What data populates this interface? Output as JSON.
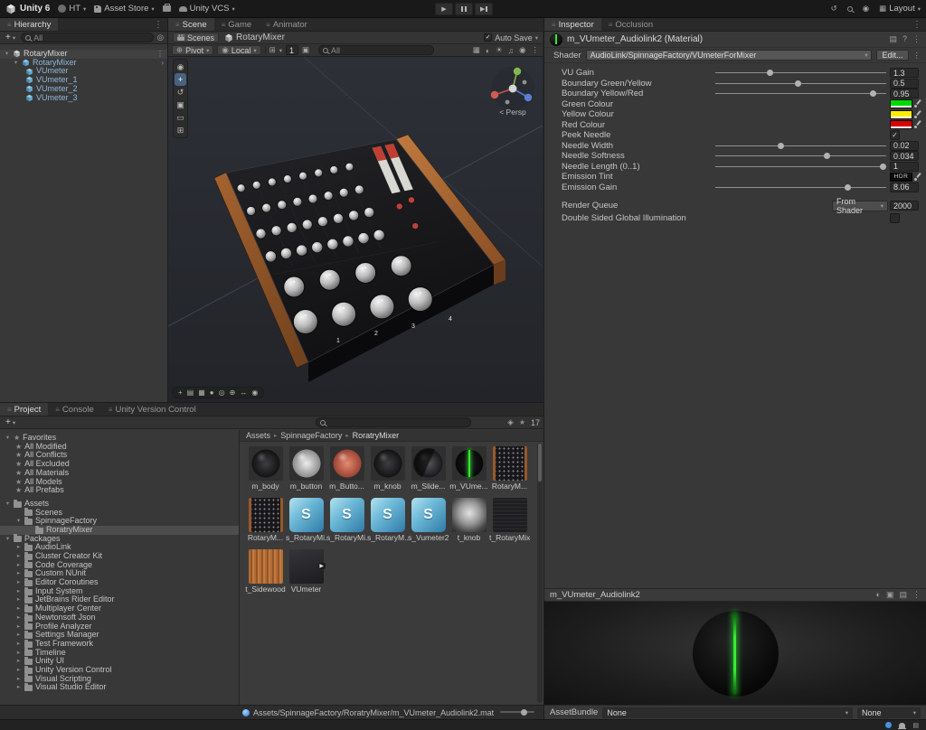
{
  "topbar": {
    "unity_version": "Unity 6",
    "account": "HT",
    "asset_store": "Asset Store",
    "unity_vcs": "Unity VCS",
    "layout": "Layout"
  },
  "hierarchy": {
    "tab": "Hierarchy",
    "search_placeholder": "All",
    "scene_name": "RotaryMixer",
    "prefab_root": "RotaryMixer",
    "children": [
      "VUmeter",
      "VUmeter_1",
      "VUmeter_2",
      "VUmeter_3"
    ]
  },
  "scene_view": {
    "tabs": [
      "Scene",
      "Game",
      "Animator"
    ],
    "scenes_button": "Scenes",
    "scene_breadcrumb": "RotaryMixer",
    "auto_save": "Auto Save",
    "pivot": "Pivot",
    "orientation": "Local",
    "grid_size": "1",
    "search_placeholder": "All",
    "gizmo_label": "< Persp",
    "channel_numbers": [
      "1",
      "2",
      "3",
      "4"
    ]
  },
  "inspector": {
    "tabs": [
      "Inspector",
      "Occlusion"
    ],
    "material_title": "m_VUmeter_Audiolink2 (Material)",
    "shader_label": "Shader",
    "shader_name": "AudioLink/SpinnageFactory/VUmeterForMixer",
    "edit_button": "Edit...",
    "properties": [
      {
        "label": "VU Gain",
        "type": "slider",
        "value": "1.3"
      },
      {
        "label": "Boundary Green/Yellow",
        "type": "slider",
        "value": "0.5"
      },
      {
        "label": "Boundary Yellow/Red",
        "type": "slider",
        "value": "0.95"
      },
      {
        "label": "Green Colour",
        "type": "color",
        "color": "#00d800"
      },
      {
        "label": "Yellow Colour",
        "type": "color",
        "color": "#ffee00"
      },
      {
        "label": "Red Colour",
        "type": "color",
        "color": "#d80000"
      },
      {
        "label": "Peek Needle",
        "type": "checkbox",
        "checked": true
      },
      {
        "label": "Needle Width",
        "type": "slider",
        "value": "0.02"
      },
      {
        "label": "Needle Softness",
        "type": "slider",
        "value": "0.034"
      },
      {
        "label": "Needle Length (0..1)",
        "type": "slider",
        "value": "1"
      },
      {
        "label": "Emission Tint",
        "type": "hdr",
        "badge": "HDR"
      },
      {
        "label": "Emission Gain",
        "type": "slider",
        "value": "8.06"
      }
    ],
    "render_queue_label": "Render Queue",
    "render_queue_mode": "From Shader",
    "render_queue_value": "2000",
    "double_sided_label": "Double Sided Global Illumination",
    "preview_title": "m_VUmeter_Audiolink2",
    "assetbundle_label": "AssetBundle",
    "assetbundle_primary": "None",
    "assetbundle_variant": "None"
  },
  "project": {
    "tabs": [
      "Project",
      "Console",
      "Unity Version Control"
    ],
    "favorites_label": "Favorites",
    "favorites": [
      "All Modified",
      "All Conflicts",
      "All Excluded",
      "All Materials",
      "All Models",
      "All Prefabs"
    ],
    "assets_label": "Assets",
    "scenes_folder": "Scenes",
    "spinnage_folder": "SpinnageFactory",
    "selected_folder": "RoratryMixer",
    "packages_label": "Packages",
    "packages": [
      "AudioLink",
      "Cluster Creator Kit",
      "Code Coverage",
      "Custom NUnit",
      "Editor Coroutines",
      "Input System",
      "JetBrains Rider Editor",
      "Multiplayer Center",
      "Newtonsoft Json",
      "Profile Analyzer",
      "Settings Manager",
      "Test Framework",
      "Timeline",
      "Unity UI",
      "Unity Version Control",
      "Visual Scripting",
      "Visual Studio Editor"
    ],
    "breadcrumb": [
      "Assets",
      "SpinnageFactory",
      "RoratryMixer"
    ],
    "hidden_count": "17",
    "items": [
      {
        "label": "m_body",
        "kind": "m-dark"
      },
      {
        "label": "m_button",
        "kind": "m-light"
      },
      {
        "label": "m_Butto...",
        "kind": "m-red"
      },
      {
        "label": "m_knob",
        "kind": "m-dark"
      },
      {
        "label": "m_Slide...",
        "kind": "m-half"
      },
      {
        "label": "m_VUme...",
        "kind": "m-vu"
      },
      {
        "label": "RotaryM...",
        "kind": "t-mixer"
      },
      {
        "label": "RotaryM...",
        "kind": "t-mixer"
      },
      {
        "label": "s_RotaryMi...",
        "kind": "shader"
      },
      {
        "label": "s_RotaryMi...",
        "kind": "shader"
      },
      {
        "label": "s_RotaryM...",
        "kind": "shader"
      },
      {
        "label": "s_Vumeter2",
        "kind": "shader"
      },
      {
        "label": "t_knob",
        "kind": "t-knob"
      },
      {
        "label": "t_RotaryMix...",
        "kind": "t-dark"
      },
      {
        "label": "t_Sidewood",
        "kind": "t-wood"
      },
      {
        "label": "VUmeter",
        "kind": "model"
      }
    ]
  },
  "statusbar": {
    "selected_path": "Assets/SpinnageFactory/RoratryMixer/m_VUmeter_Audiolink2.mat"
  }
}
